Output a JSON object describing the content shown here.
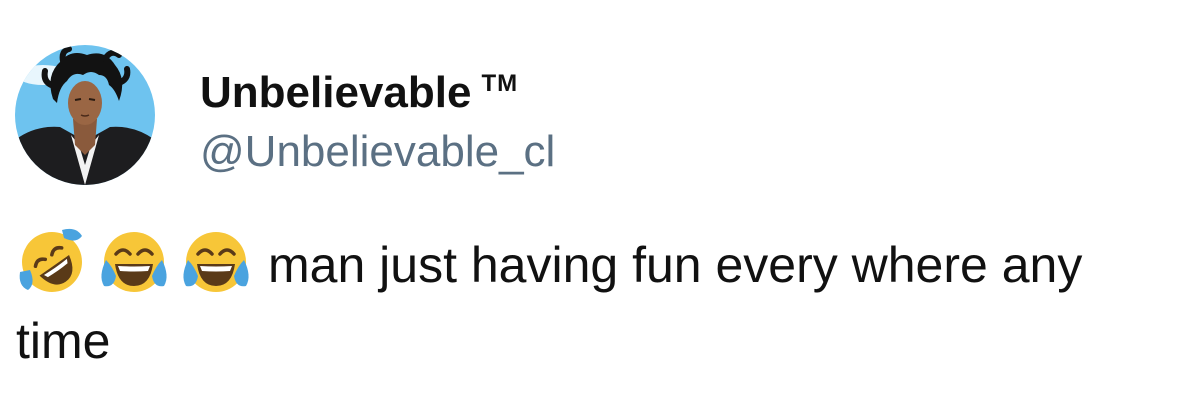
{
  "tweet": {
    "author": {
      "display_name": "Unbelievable",
      "name_suffix": "TM",
      "handle": "@Unbelievable_cl",
      "avatar_icon": "anime-character-avatar"
    },
    "emojis": [
      "rolling-on-floor-laughing-icon",
      "face-with-tears-of-joy-icon",
      "face-with-tears-of-joy-icon"
    ],
    "text": "man just having fun every where any time"
  },
  "colors": {
    "handle": "#5b7083",
    "text": "#111111",
    "emoji_face": "#f7c638",
    "tear": "#4aa3df",
    "sky": "#6ec3ef"
  }
}
